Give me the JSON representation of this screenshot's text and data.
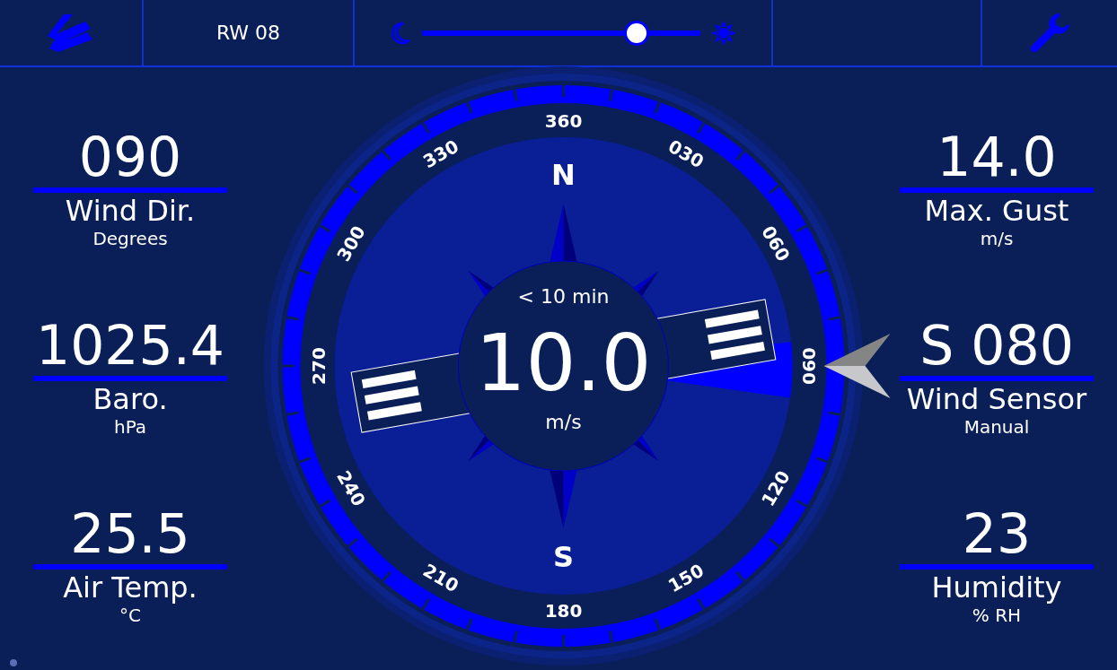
{
  "top_bar": {
    "runway": "RW 08",
    "brightness": {
      "level": 0.77
    }
  },
  "left_readouts": [
    {
      "value": "090",
      "label": "Wind Dir.",
      "unit": "Degrees"
    },
    {
      "value": "1025.4",
      "label": "Baro.",
      "unit": "hPa"
    },
    {
      "value": "25.5",
      "label": "Air Temp.",
      "unit": "°C"
    }
  ],
  "compass": {
    "bearings": [
      "360",
      "030",
      "060",
      "090",
      "120",
      "150",
      "180",
      "210",
      "240",
      "270",
      "300",
      "330"
    ],
    "cardinals": [
      "N",
      "S"
    ],
    "period": "< 10 min",
    "speed": "10.0",
    "speed_unit": "m/s"
  },
  "right_readouts": [
    {
      "value": "14.0",
      "label": "Max. Gust",
      "unit": "m/s"
    },
    {
      "value": "S 080",
      "label": "Wind Sensor",
      "unit": "Manual"
    },
    {
      "value": "23",
      "label": "Humidity",
      "unit": "% RH"
    }
  ]
}
